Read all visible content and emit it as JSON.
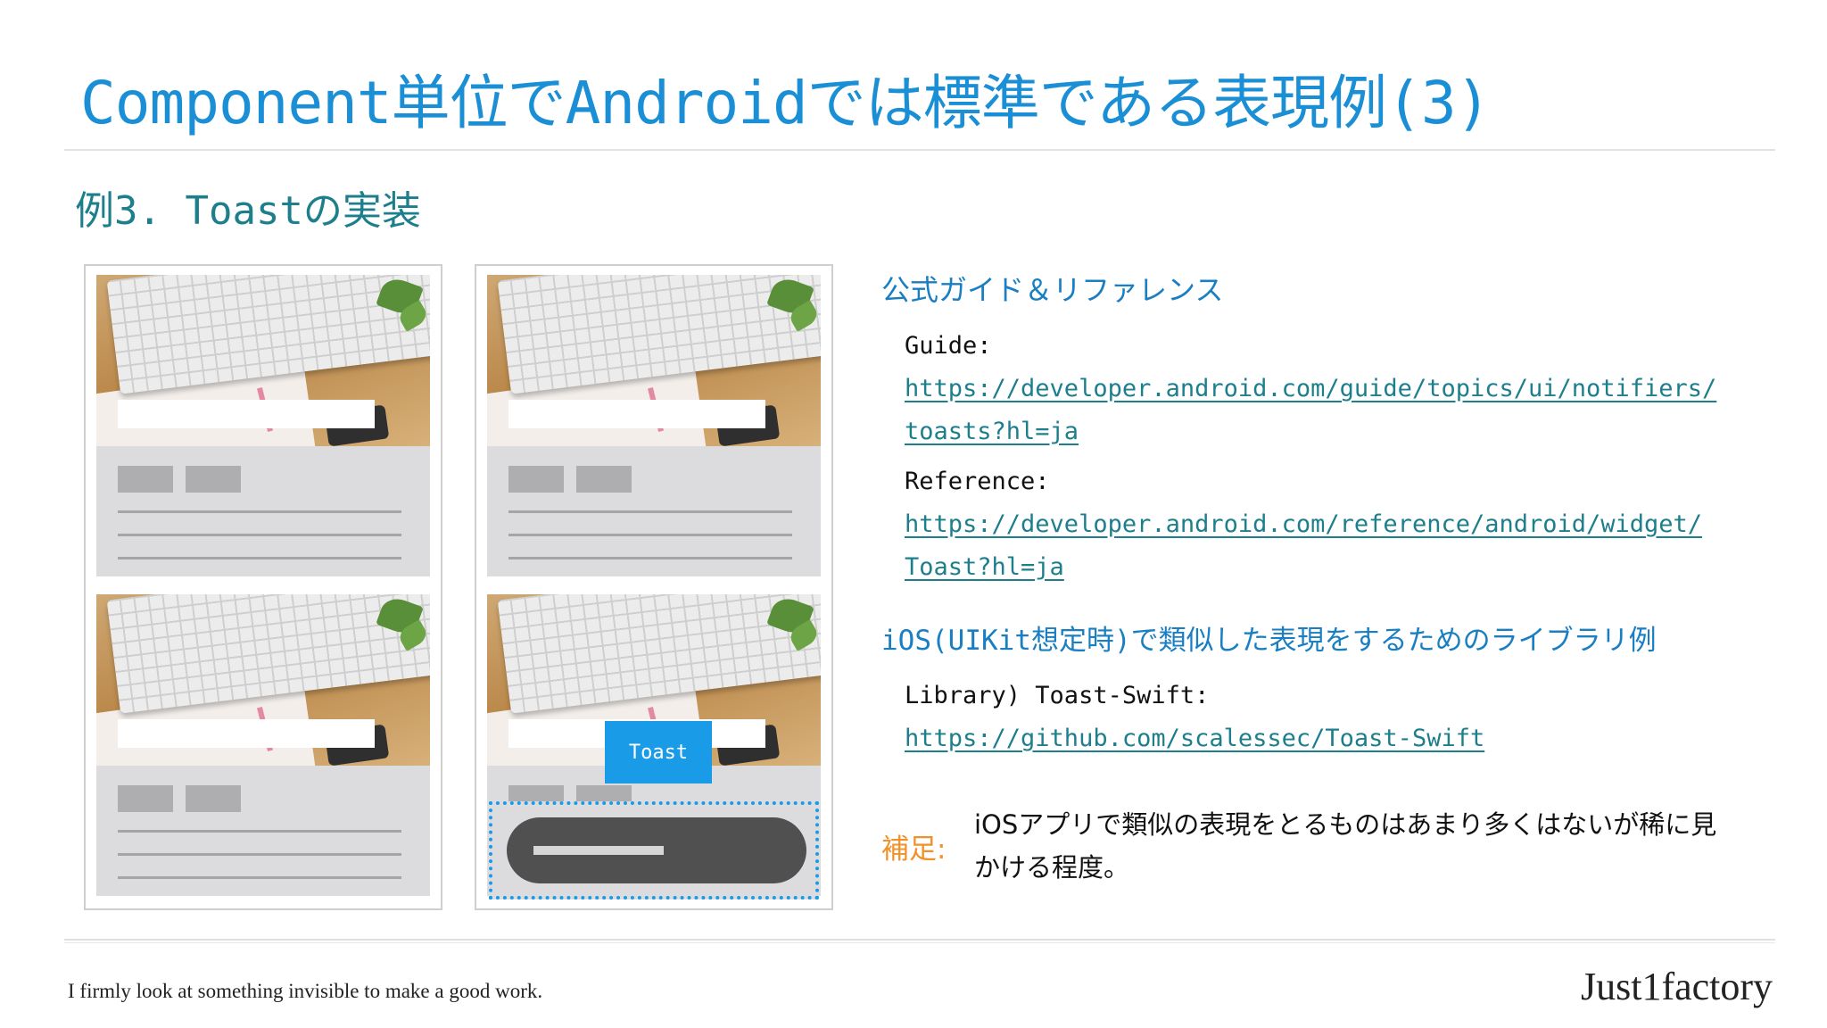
{
  "slide": {
    "title": "Component単位でAndroidでは標準である表現例(3)",
    "subtitle": "例3. Toastの実装"
  },
  "mockup": {
    "toast_label": "Toast"
  },
  "reference": {
    "heading": "公式ガイド＆リファレンス",
    "guide_label": "Guide:",
    "guide_url_line1": "https://developer.android.com/guide/topics/ui/notifiers/",
    "guide_url_line2": "toasts?hl=ja",
    "reference_label": "Reference:",
    "reference_url_line1": "https://developer.android.com/reference/android/widget/",
    "reference_url_line2": "Toast?hl=ja"
  },
  "ios": {
    "heading": "iOS(UIKit想定時)で類似した表現をするためのライブラリ例",
    "library_label": "Library) Toast-Swift:",
    "library_url": "https://github.com/scalessec/Toast-Swift"
  },
  "note": {
    "label": "補足:",
    "text": "iOSアプリで類似の表現をとるものはあまり多くはないが稀に見かける程度。"
  },
  "footer": {
    "quote": "I firmly look at something invisible to make a good work.",
    "brand": "Just1factory"
  },
  "colors": {
    "title": "#1a8fd6",
    "subtitle": "#1d7f8c",
    "link": "#1d7f8c",
    "toast_accent": "#1a9be8",
    "note_label": "#f0922a"
  }
}
